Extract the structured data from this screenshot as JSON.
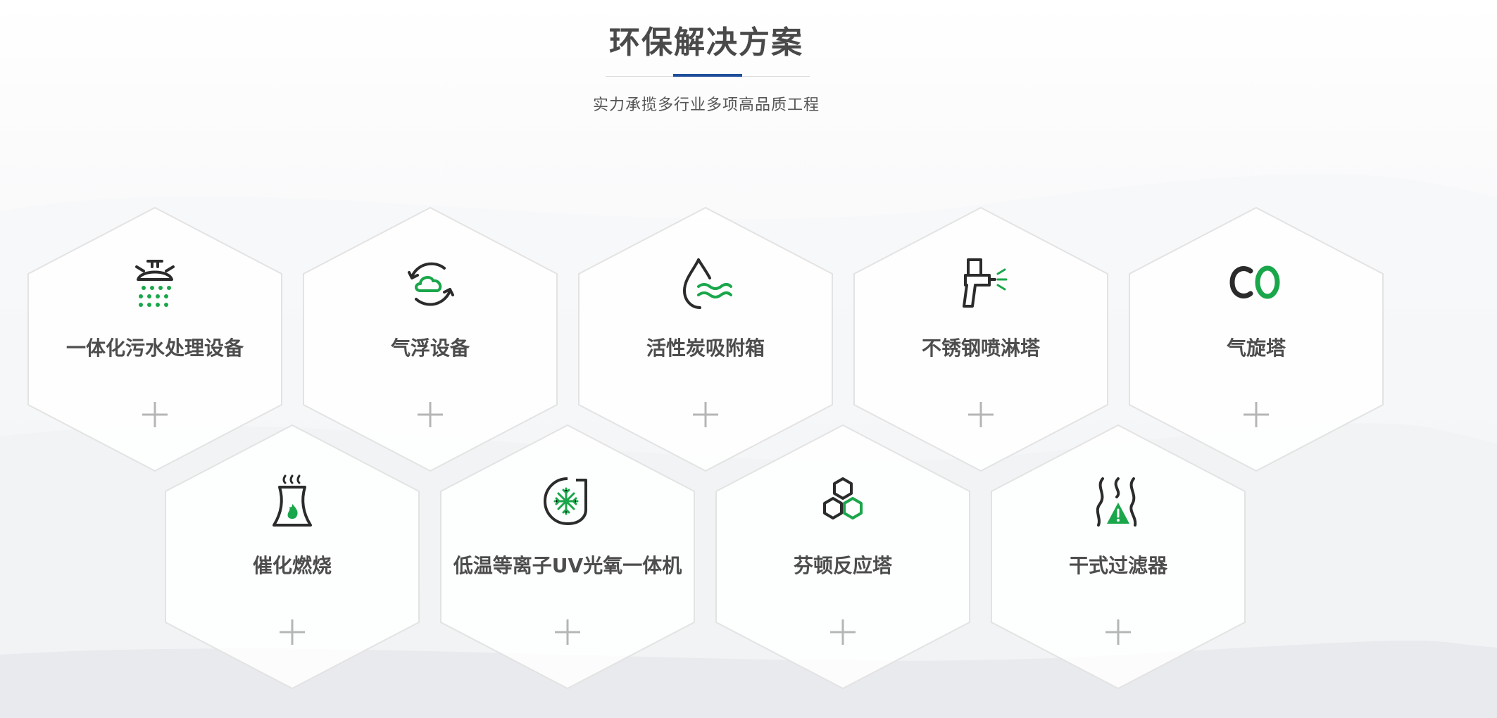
{
  "header": {
    "title": "环保解决方案",
    "subtitle": "实力承揽多行业多项高品质工程"
  },
  "colors": {
    "accent_blue": "#1f4e9b",
    "icon_green": "#1aa64a",
    "icon_dark": "#2b2b2b",
    "text_dark": "#4d4d4d",
    "hex_border": "#e3e3e3"
  },
  "solutions": [
    {
      "label": "一体化污水处理设备",
      "icon": "shower-drops-icon"
    },
    {
      "label": "气浮设备",
      "icon": "cloud-cycle-icon"
    },
    {
      "label": "活性炭吸附箱",
      "icon": "water-drop-waves-icon"
    },
    {
      "label": "不锈钢喷淋塔",
      "icon": "spray-gun-icon"
    },
    {
      "label": "气旋塔",
      "icon": "co-text-icon"
    },
    {
      "label": "催化燃烧",
      "icon": "cooling-tower-flame-icon"
    },
    {
      "label": "低温等离子UV光氧一体机",
      "icon": "snowflake-fan-icon"
    },
    {
      "label": "芬顿反应塔",
      "icon": "hexagon-molecule-icon"
    },
    {
      "label": "干式过滤器",
      "icon": "steam-warning-icon"
    }
  ]
}
